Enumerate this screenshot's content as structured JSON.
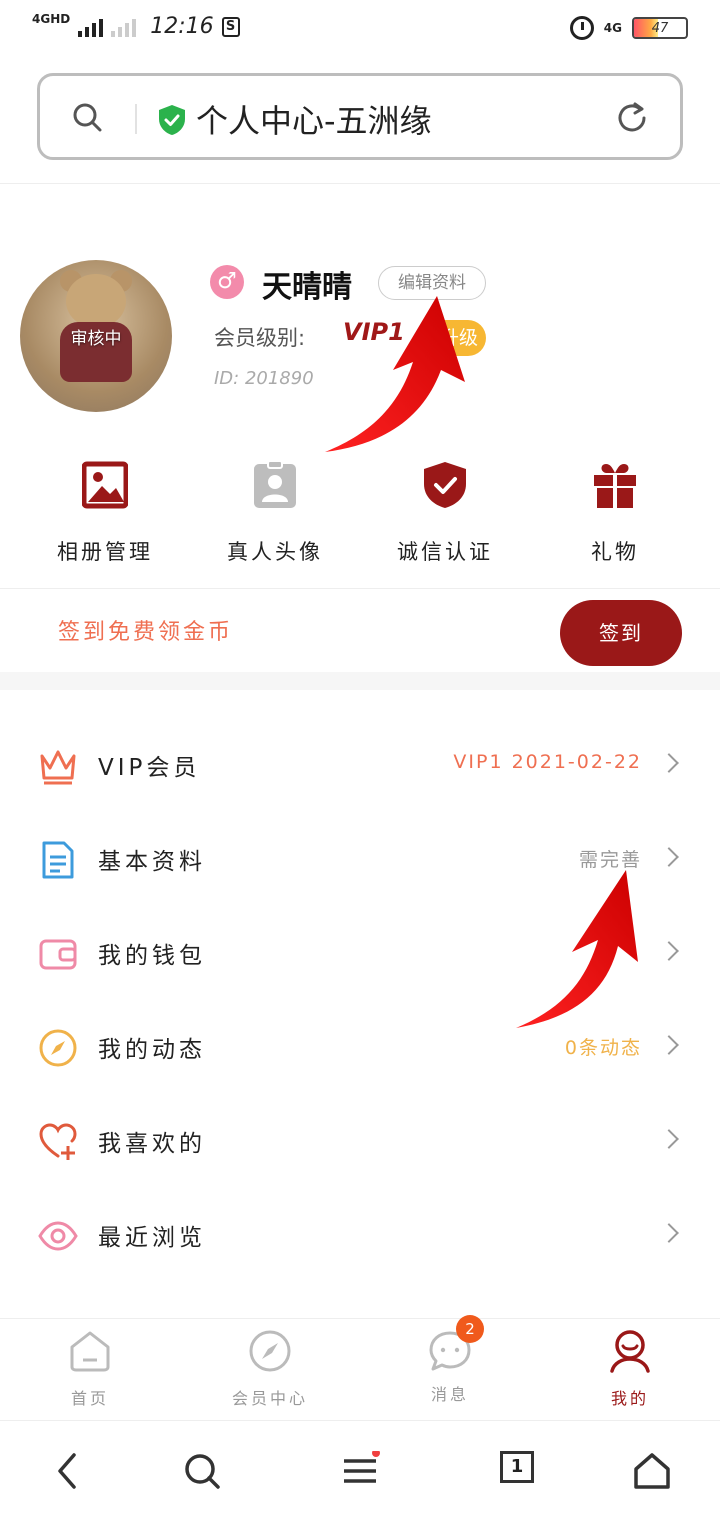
{
  "status_bar": {
    "network_left": "4GHD",
    "time": "12:16",
    "network_right": "4G",
    "battery": "47"
  },
  "search": {
    "title": "个人中心-五洲缘"
  },
  "profile": {
    "avatar_badge": "审核中",
    "username": "天晴晴",
    "edit_label": "编辑资料",
    "level_label": "会员级别:",
    "level_value": "VIP1",
    "upgrade_label": "升级",
    "id_text": "ID: 201890"
  },
  "quick_actions": [
    {
      "label": "相册管理",
      "icon": "photo-album-icon"
    },
    {
      "label": "真人头像",
      "icon": "id-badge-icon"
    },
    {
      "label": "诚信认证",
      "icon": "shield-check-icon"
    },
    {
      "label": "礼物",
      "icon": "gift-icon"
    }
  ],
  "signin": {
    "text": "签到免费领金币",
    "button": "签到"
  },
  "menu": [
    {
      "label": "VIP会员",
      "value": "VIP1 2021-02-22",
      "value_color": "#ef6f51",
      "icon": "crown-icon"
    },
    {
      "label": "基本资料",
      "value": "需完善",
      "value_color": "#999999",
      "icon": "document-icon"
    },
    {
      "label": "我的钱包",
      "value": "",
      "value_color": "#999999",
      "icon": "wallet-icon"
    },
    {
      "label": "我的动态",
      "value": "0条动态",
      "value_color": "#f0b24a",
      "icon": "compass-icon"
    },
    {
      "label": "我喜欢的",
      "value": "",
      "value_color": "#999999",
      "icon": "heart-plus-icon"
    },
    {
      "label": "最近浏览",
      "value": "",
      "value_color": "#999999",
      "icon": "eye-icon"
    }
  ],
  "bottom_nav": [
    {
      "label": "首页",
      "icon": "home-icon"
    },
    {
      "label": "会员中心",
      "icon": "compass-icon"
    },
    {
      "label": "消息",
      "icon": "chat-icon",
      "badge": "2"
    },
    {
      "label": "我的",
      "icon": "user-icon"
    }
  ],
  "browser_bar": {
    "tab_count": "1"
  },
  "colors": {
    "brand": "#9a1818",
    "accent_orange": "#ef6f51",
    "gold": "#f7b733"
  }
}
